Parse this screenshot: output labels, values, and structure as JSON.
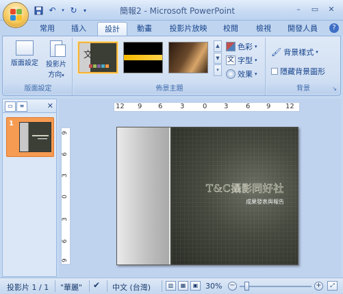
{
  "window": {
    "title": "簡報2 - Microsoft PowerPoint",
    "qat": [
      "save-icon",
      "undo-icon",
      "redo-icon",
      "customize-icon"
    ],
    "controls": [
      "minimize-icon",
      "restore-icon",
      "close-icon"
    ]
  },
  "tabs": [
    {
      "label": "常用"
    },
    {
      "label": "插入"
    },
    {
      "label": "設計",
      "active": true
    },
    {
      "label": "動畫"
    },
    {
      "label": "投影片放映"
    },
    {
      "label": "校閱"
    },
    {
      "label": "檢視"
    },
    {
      "label": "開發人員"
    }
  ],
  "ribbon": {
    "page_setup": {
      "label": "版面設定",
      "page_setup_btn": "版面設定",
      "orientation_btn_line1": "投影片",
      "orientation_btn_line2": "方向"
    },
    "themes": {
      "label": "佈景主題",
      "colors": "色彩",
      "fonts": "字型",
      "effects": "效果",
      "thumb_glyph": "文"
    },
    "background": {
      "label": "背景",
      "styles": "背景樣式",
      "hide_graphics": "隱藏背景圖形"
    }
  },
  "slides_panel": {
    "slide_number": "1"
  },
  "ruler": {
    "horizontal": [
      "12",
      "9",
      "6",
      "3",
      "0",
      "3",
      "6",
      "9",
      "12"
    ],
    "vertical": [
      "9",
      "6",
      "3",
      "0",
      "3",
      "6",
      "9"
    ]
  },
  "slide": {
    "title": "T&C攝影同好社",
    "subtitle": "成果發表與報告"
  },
  "status": {
    "slide_info": "投影片 1 / 1",
    "theme_name": "\"華麗\"",
    "language": "中文 (台灣)",
    "zoom": "30%",
    "zoom_level_fraction": 0.3
  }
}
